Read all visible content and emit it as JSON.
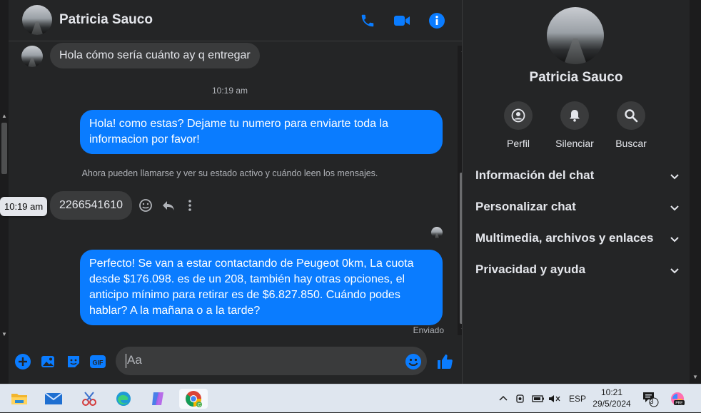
{
  "contact": {
    "name": "Patricia Sauco"
  },
  "header_icons": [
    "phone-icon",
    "video-camera-icon",
    "info-icon"
  ],
  "messages": {
    "incoming_1": "Hola cómo sería cuánto ay q entregar",
    "time_1": "10:19 am",
    "outgoing_1": "Hola! como estas? Dejame tu numero para enviarte toda la informacion por favor!",
    "notice": "Ahora pueden llamarse y ver su estado activo y cuándo leen los mensajes.",
    "tooltip_time": "10:19 am",
    "incoming_2": "2266541610",
    "outgoing_2": "Perfecto!  Se van a estar contactando de Peugeot 0km, La cuota desde $176.098. es de un 208, también hay otras opciones, el anticipo mínimo para retirar es de $6.827.850. Cuándo podes hablar? A la mañana o a la tarde?",
    "status": "Enviado"
  },
  "composer": {
    "placeholder": "Aa"
  },
  "sidebar": {
    "name": "Patricia Sauco",
    "actions": [
      {
        "label": "Perfil",
        "icon": "profile-icon"
      },
      {
        "label": "Silenciar",
        "icon": "bell-icon"
      },
      {
        "label": "Buscar",
        "icon": "search-icon"
      }
    ],
    "sections": [
      "Información del chat",
      "Personalizar chat",
      "Multimedia, archivos y enlaces",
      "Privacidad y ayuda"
    ]
  },
  "taskbar": {
    "apps": [
      "file-explorer-icon",
      "mail-icon",
      "snipping-tool-icon",
      "edge-icon",
      "copilot-icon",
      "chrome-icon"
    ],
    "lang": "ESP",
    "time": "10:21",
    "date": "29/5/2024",
    "notifications": "3"
  },
  "colors": {
    "accent": "#0a7cff",
    "bg": "#242526",
    "bubble_in": "#3a3b3c"
  }
}
